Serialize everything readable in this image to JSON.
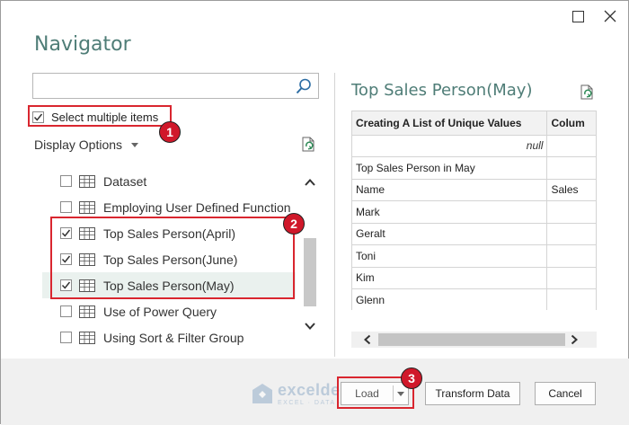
{
  "window": {
    "title": "Navigator"
  },
  "search": {
    "value": "",
    "placeholder": ""
  },
  "select_multiple": {
    "label": "Select multiple items",
    "checked": true
  },
  "display_options": {
    "label": "Display Options"
  },
  "tree": {
    "items": [
      {
        "label": "Dataset",
        "checked": false
      },
      {
        "label": "Employing User Defined Function",
        "checked": false
      },
      {
        "label": "Top Sales Person(April)",
        "checked": true
      },
      {
        "label": "Top Sales Person(June)",
        "checked": true
      },
      {
        "label": "Top Sales Person(May)",
        "checked": true,
        "selected": true
      },
      {
        "label": "Use of Power Query",
        "checked": false
      },
      {
        "label": "Using Sort & Filter Group",
        "checked": false
      }
    ]
  },
  "preview": {
    "title": "Top Sales Person(May)",
    "columns": [
      "Creating A List of Unique Values",
      "Colum"
    ],
    "rows": [
      [
        "null",
        ""
      ],
      [
        "Top Sales Person in May",
        ""
      ],
      [
        "Name",
        "Sales"
      ],
      [
        "Mark",
        ""
      ],
      [
        "Geralt",
        ""
      ],
      [
        "Toni",
        ""
      ],
      [
        "Kim",
        ""
      ],
      [
        "Glenn",
        ""
      ]
    ]
  },
  "buttons": {
    "load": "Load",
    "transform": "Transform Data",
    "cancel": "Cancel"
  },
  "callouts": [
    "1",
    "2",
    "3"
  ],
  "watermark": {
    "brand": "exceldemy",
    "tagline": "EXCEL · DATA · BI"
  },
  "colors": {
    "accent": "#4f7d77",
    "callout": "#d0182a"
  }
}
